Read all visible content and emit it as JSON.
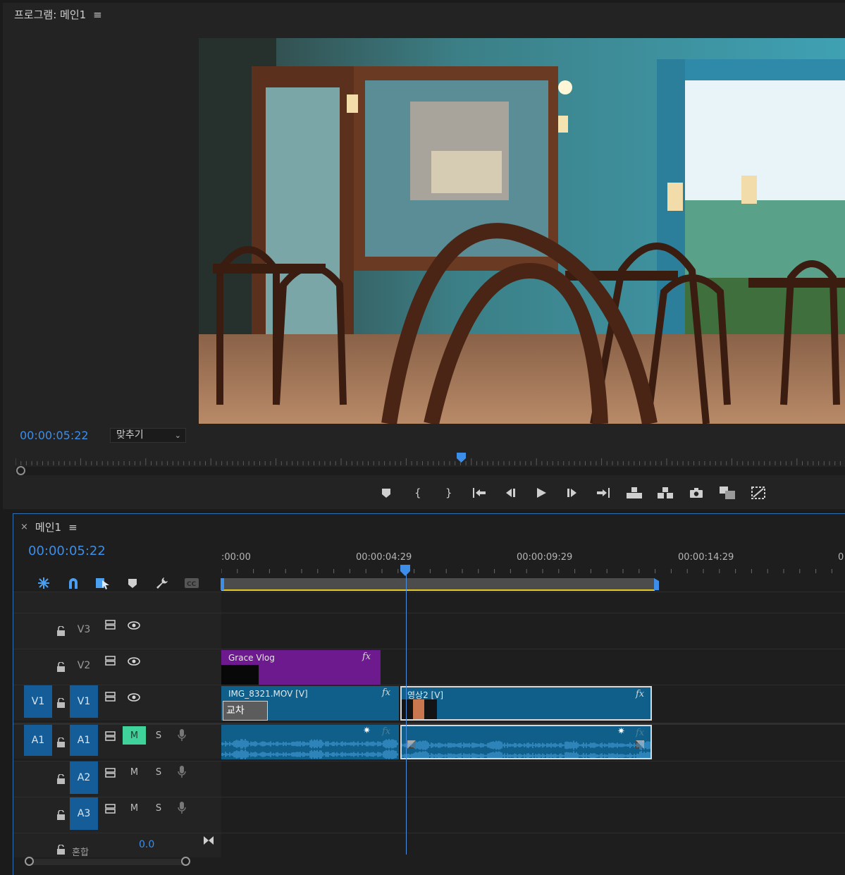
{
  "program_monitor": {
    "title": "프로그램: 메인1",
    "menu_icon": "≡",
    "timecode": "00:00:05:22",
    "fit_label": "맞추기",
    "transport_buttons": [
      "add-marker",
      "mark-in",
      "mark-out",
      "go-to-in",
      "step-back",
      "play",
      "step-forward",
      "go-to-out",
      "lift",
      "extract",
      "export-frame",
      "insert",
      "overwrite"
    ]
  },
  "timeline": {
    "close_icon": "×",
    "title": "메인1",
    "menu_icon": "≡",
    "timecode": "00:00:05:22",
    "tools": [
      "nest-icon",
      "snap-magnet-icon",
      "linked-selection-icon",
      "add-marker-icon",
      "wrench-icon",
      "captions-icon"
    ],
    "ruler_labels": [
      ":00:00",
      "00:00:04:29",
      "00:00:09:29",
      "00:00:14:29",
      "0"
    ],
    "tracks": {
      "V3": {
        "target": "V3"
      },
      "V2": {
        "target": "V2"
      },
      "V1": {
        "source": "V1",
        "target": "V1"
      },
      "A1": {
        "source": "A1",
        "target": "A1",
        "mute": "M",
        "solo": "S"
      },
      "A2": {
        "target": "A2",
        "mute": "M",
        "solo": "S"
      },
      "A3": {
        "target": "A3",
        "mute": "M",
        "solo": "S"
      }
    },
    "mix": {
      "label": "혼합",
      "value": "0.0"
    },
    "clips": {
      "v2_title": "Grace Vlog",
      "v1_clip1": "IMG_8321.MOV [V]",
      "v1_clip2": "영상2 [V]",
      "transition": "교차",
      "fx": "fx"
    }
  }
}
